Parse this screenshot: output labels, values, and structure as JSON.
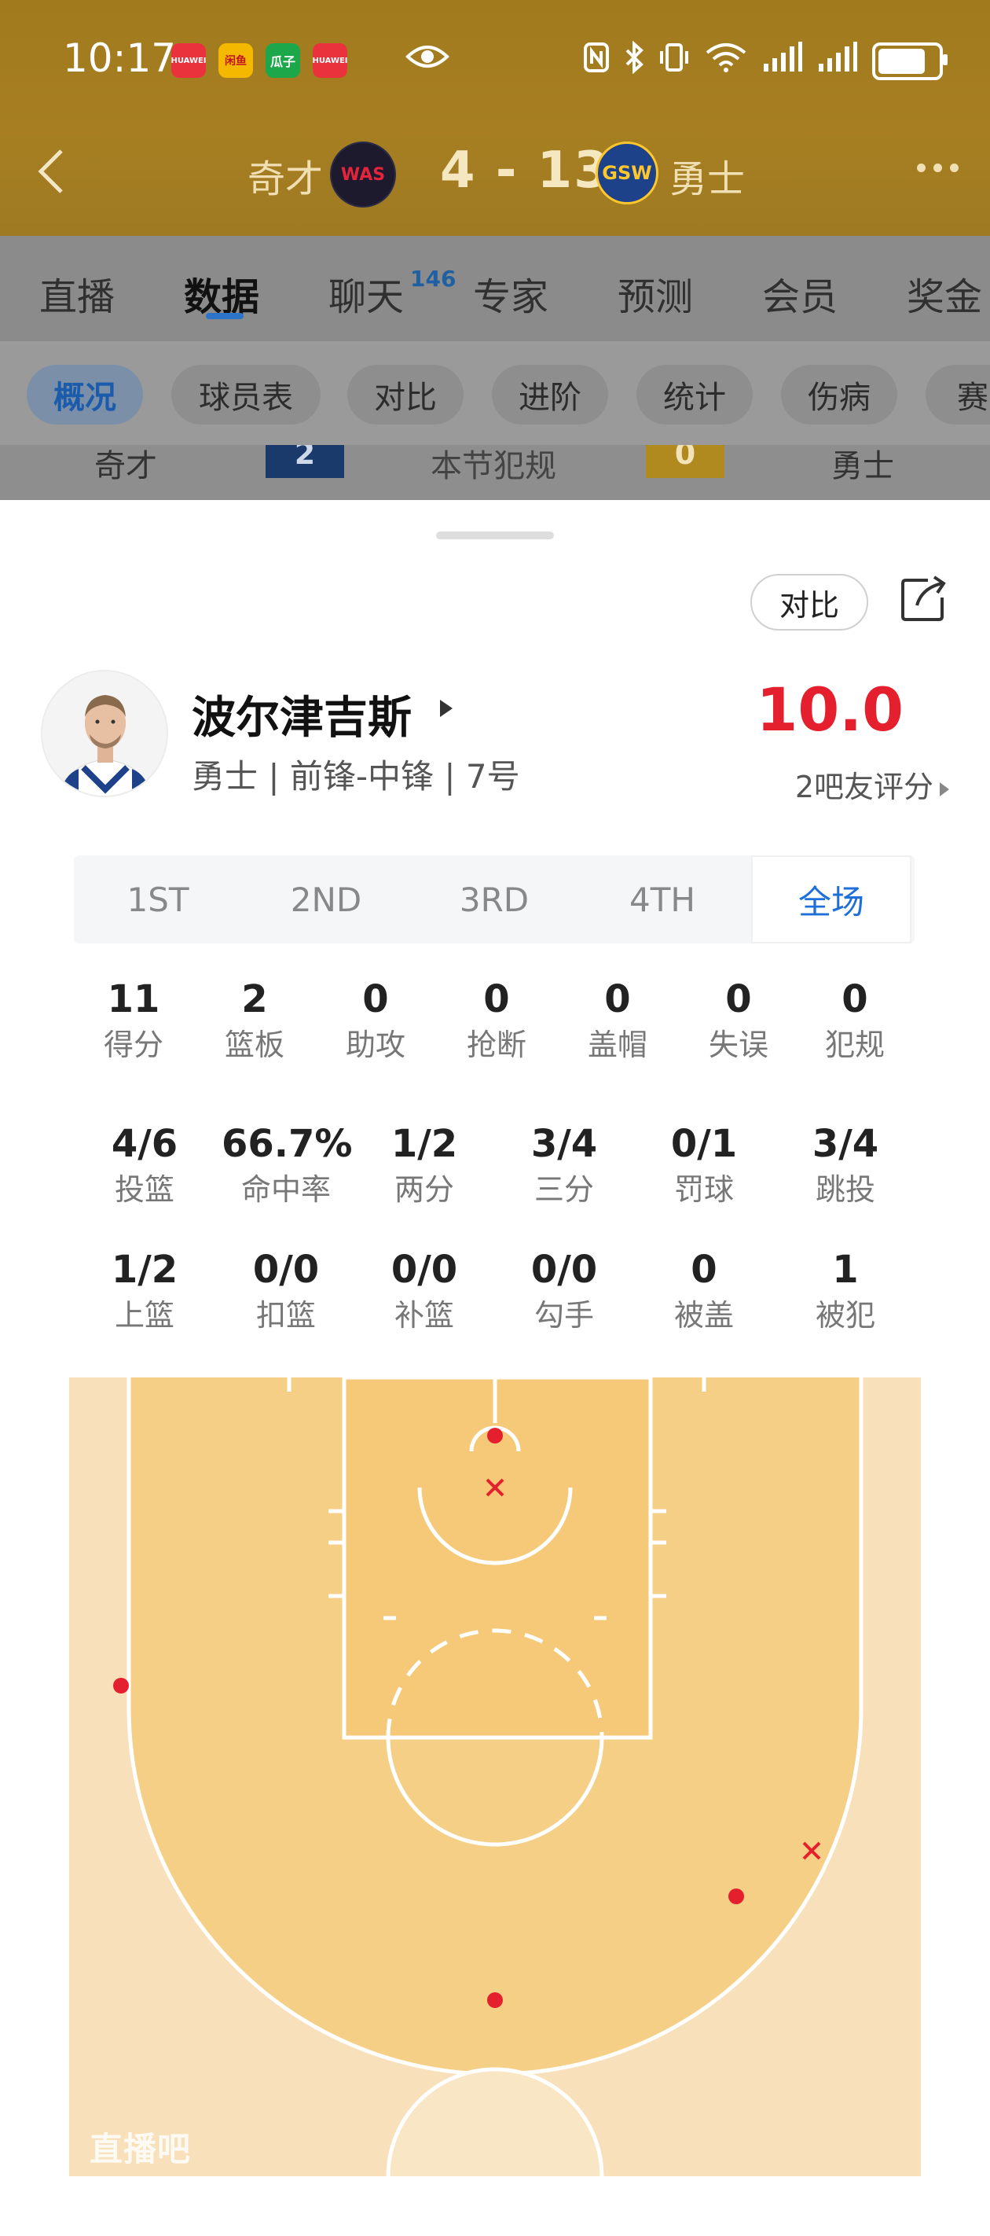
{
  "status_bar": {
    "time": "10:17",
    "apps": [
      {
        "name": "huawei-icon",
        "label": "HUAWEI",
        "color": "#e9323c"
      },
      {
        "name": "app-yellow-icon",
        "label": "闲鱼",
        "color": "#f5b800"
      },
      {
        "name": "app-green-icon",
        "label": "瓜子",
        "color": "#1ca84a"
      },
      {
        "name": "huawei-icon-2",
        "label": "HUAWEI",
        "color": "#e9323c"
      }
    ],
    "battery_level": 0.9
  },
  "header": {
    "away_team": "奇才",
    "away_abbr": "WAS",
    "score": "4 - 13",
    "home_abbr": "GSW",
    "home_team": "勇士"
  },
  "tabs": {
    "items": [
      "直播",
      "数据",
      "聊天",
      "专家",
      "预测",
      "会员",
      "奖金"
    ],
    "active": "数据",
    "chat_badge": "146"
  },
  "subtabs": {
    "items": [
      "概况",
      "球员表",
      "对比",
      "进阶",
      "统计",
      "伤病",
      "赛"
    ],
    "active": "概况"
  },
  "peek_row": {
    "left_team": "奇才",
    "left_value": "2",
    "label": "本节犯规",
    "right_value": "0",
    "right_team": "勇士"
  },
  "sheet": {
    "compare_label": "对比",
    "player_name": "波尔津吉斯",
    "player_meta": "勇士 | 前锋-中锋 | 7号",
    "rating": "10.0",
    "rating_sub": "2吧友评分"
  },
  "quarters": {
    "items": [
      "1ST",
      "2ND",
      "3RD",
      "4TH",
      "全场"
    ],
    "active": "全场"
  },
  "stats_row1": [
    {
      "value": "11",
      "label": "得分"
    },
    {
      "value": "2",
      "label": "篮板"
    },
    {
      "value": "0",
      "label": "助攻"
    },
    {
      "value": "0",
      "label": "抢断"
    },
    {
      "value": "0",
      "label": "盖帽"
    },
    {
      "value": "0",
      "label": "失误"
    },
    {
      "value": "0",
      "label": "犯规"
    }
  ],
  "stats_row2": [
    {
      "value": "4/6",
      "label": "投篮"
    },
    {
      "value": "66.7%",
      "label": "命中率"
    },
    {
      "value": "1/2",
      "label": "两分"
    },
    {
      "value": "3/4",
      "label": "三分"
    },
    {
      "value": "0/1",
      "label": "罚球"
    },
    {
      "value": "3/4",
      "label": "跳投"
    }
  ],
  "stats_row3": [
    {
      "value": "1/2",
      "label": "上篮"
    },
    {
      "value": "0/0",
      "label": "扣篮"
    },
    {
      "value": "0/0",
      "label": "补篮"
    },
    {
      "value": "0/0",
      "label": "勾手"
    },
    {
      "value": "0",
      "label": "被盖"
    },
    {
      "value": "1",
      "label": "被犯"
    }
  ],
  "shot_chart": {
    "made_color": "#e5202e",
    "missed_color": "#e5202e",
    "shots": [
      {
        "result": "made",
        "zone": "restricted area"
      },
      {
        "result": "missed",
        "zone": "restricted area"
      },
      {
        "result": "made",
        "zone": "left corner three"
      },
      {
        "result": "made",
        "zone": "right wing three"
      },
      {
        "result": "missed",
        "zone": "right wing three"
      },
      {
        "result": "made",
        "zone": "top of key three"
      }
    ],
    "watermark": "直播吧"
  }
}
